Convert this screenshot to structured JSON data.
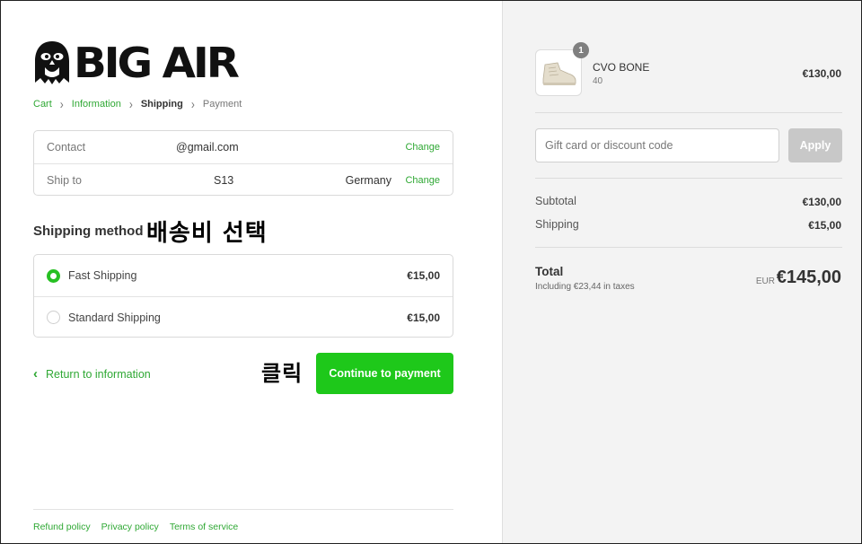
{
  "brand": {
    "name": "BIG AIR",
    "accent_color": "#2fa834",
    "button_color": "#1ec81a"
  },
  "breadcrumb": {
    "cart": "Cart",
    "information": "Information",
    "shipping": "Shipping",
    "payment": "Payment"
  },
  "review": {
    "contact_label": "Contact",
    "contact_value": "@gmail.com",
    "ship_to_label": "Ship to",
    "ship_to_value": "S13",
    "ship_to_country": "Germany",
    "change_label": "Change"
  },
  "shipping_method": {
    "title": "Shipping method",
    "options": [
      {
        "name": "Fast Shipping",
        "price": "€15,00",
        "selected": true
      },
      {
        "name": "Standard Shipping",
        "price": "€15,00",
        "selected": false
      }
    ]
  },
  "annotations": {
    "select_shipping": "배송비 선택",
    "click": "클릭"
  },
  "actions": {
    "return_label": "Return to information",
    "continue_label": "Continue to payment"
  },
  "footer": {
    "refund": "Refund policy",
    "privacy": "Privacy policy",
    "terms": "Terms of service"
  },
  "order": {
    "item": {
      "name": "CVO BONE",
      "variant": "40",
      "price": "€130,00",
      "quantity": "1"
    },
    "discount_placeholder": "Gift card or discount code",
    "apply_label": "Apply",
    "subtotal_label": "Subtotal",
    "subtotal_value": "€130,00",
    "shipping_label": "Shipping",
    "shipping_value": "€15,00",
    "total_label": "Total",
    "taxes_note": "Including €23,44 in taxes",
    "currency": "EUR",
    "total_value": "€145,00"
  }
}
